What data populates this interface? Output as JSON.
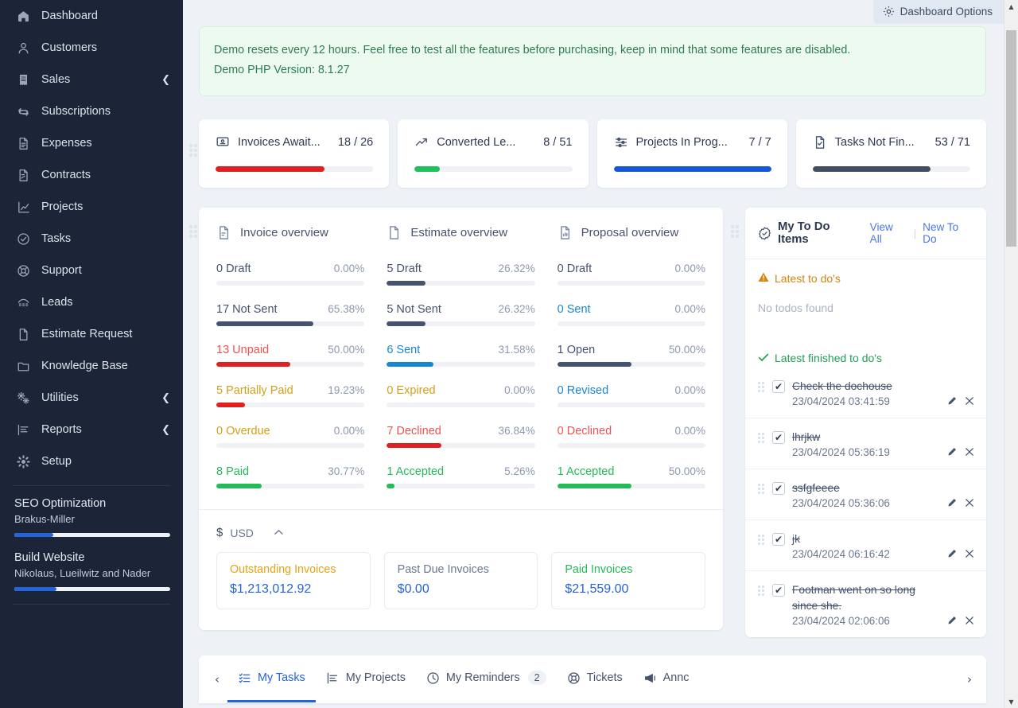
{
  "sidebar": {
    "items": [
      {
        "label": "Dashboard",
        "icon": "home-icon",
        "chevron": false
      },
      {
        "label": "Customers",
        "icon": "user-icon",
        "chevron": false
      },
      {
        "label": "Sales",
        "icon": "receipt-icon",
        "chevron": true
      },
      {
        "label": "Subscriptions",
        "icon": "refresh-icon",
        "chevron": false
      },
      {
        "label": "Expenses",
        "icon": "file-lines-icon",
        "chevron": false
      },
      {
        "label": "Contracts",
        "icon": "file-signature-icon",
        "chevron": false
      },
      {
        "label": "Projects",
        "icon": "chart-icon",
        "chevron": false
      },
      {
        "label": "Tasks",
        "icon": "check-circle-icon",
        "chevron": false
      },
      {
        "label": "Support",
        "icon": "lifebuoy-icon",
        "chevron": false
      },
      {
        "label": "Leads",
        "icon": "phone-icon",
        "chevron": false
      },
      {
        "label": "Estimate Request",
        "icon": "file-icon",
        "chevron": false
      },
      {
        "label": "Knowledge Base",
        "icon": "folder-icon",
        "chevron": false
      },
      {
        "label": "Utilities",
        "icon": "gears-icon",
        "chevron": true
      },
      {
        "label": "Reports",
        "icon": "report-icon",
        "chevron": true
      },
      {
        "label": "Setup",
        "icon": "gear-icon",
        "chevron": false
      }
    ],
    "projects": [
      {
        "title": "SEO Optimization",
        "client": "Brakus-Miller",
        "progress": 25
      },
      {
        "title": "Build Website",
        "client": "Nikolaus, Lueilwitz and Nader",
        "progress": 27
      }
    ]
  },
  "header": {
    "dashboard_options": "Dashboard Options"
  },
  "alert": {
    "line1": "Demo resets every 12 hours. Feel free to test all the features before purchasing, keep in mind that some features are disabled.",
    "line2": "Demo PHP Version: 8.1.27"
  },
  "kpis": [
    {
      "label": "Invoices Await...",
      "value": "18 / 26",
      "icon": "invoice-icon",
      "percent": 69,
      "color": "#e02020"
    },
    {
      "label": "Converted Le...",
      "value": "8 / 51",
      "icon": "trend-up-icon",
      "percent": 16,
      "color": "#1fc15c"
    },
    {
      "label": "Projects In Prog...",
      "value": "7 / 7",
      "icon": "sliders-icon",
      "percent": 100,
      "color": "#1657d9"
    },
    {
      "label": "Tasks Not Fin...",
      "value": "53 / 71",
      "icon": "task-file-icon",
      "percent": 75,
      "color": "#434e63"
    }
  ],
  "overview": [
    {
      "title": "Invoice overview",
      "icon": "invoice-doc-icon",
      "rows": [
        {
          "label": "0 Draft",
          "percent": "0.00%",
          "bar": 0,
          "color": "#46536e",
          "text_color": "#46536e"
        },
        {
          "label": "17 Not Sent",
          "percent": "65.38%",
          "bar": 65.38,
          "color": "#46536e",
          "text_color": "#46536e"
        },
        {
          "label": "13 Unpaid",
          "percent": "50.00%",
          "bar": 50,
          "color": "#e02020",
          "text_color": "#f05252"
        },
        {
          "label": "5 Partially Paid",
          "percent": "19.23%",
          "bar": 19.23,
          "color": "#e02020",
          "text_color": "#d4a017"
        },
        {
          "label": "0 Overdue",
          "percent": "0.00%",
          "bar": 0,
          "color": "#d4a017",
          "text_color": "#d4a017"
        },
        {
          "label": "8 Paid",
          "percent": "30.77%",
          "bar": 30.77,
          "color": "#22bb55",
          "text_color": "#22bb55"
        }
      ]
    },
    {
      "title": "Estimate overview",
      "icon": "estimate-doc-icon",
      "rows": [
        {
          "label": "5 Draft",
          "percent": "26.32%",
          "bar": 26.32,
          "color": "#46536e",
          "text_color": "#46536e"
        },
        {
          "label": "5 Not Sent",
          "percent": "26.32%",
          "bar": 26.32,
          "color": "#46536e",
          "text_color": "#46536e"
        },
        {
          "label": "6 Sent",
          "percent": "31.58%",
          "bar": 31.58,
          "color": "#1787d4",
          "text_color": "#1787d4"
        },
        {
          "label": "0 Expired",
          "percent": "0.00%",
          "bar": 0,
          "color": "#d4a017",
          "text_color": "#d4a017"
        },
        {
          "label": "7 Declined",
          "percent": "36.84%",
          "bar": 36.84,
          "color": "#e02020",
          "text_color": "#f05252"
        },
        {
          "label": "1 Accepted",
          "percent": "5.26%",
          "bar": 5.26,
          "color": "#22bb55",
          "text_color": "#22bb55"
        }
      ]
    },
    {
      "title": "Proposal overview",
      "icon": "proposal-doc-icon",
      "rows": [
        {
          "label": "0 Draft",
          "percent": "0.00%",
          "bar": 0,
          "color": "#46536e",
          "text_color": "#46536e"
        },
        {
          "label": "0 Sent",
          "percent": "0.00%",
          "bar": 0,
          "color": "#1787d4",
          "text_color": "#1787d4"
        },
        {
          "label": "1 Open",
          "percent": "50.00%",
          "bar": 50,
          "color": "#46536e",
          "text_color": "#46536e"
        },
        {
          "label": "0 Revised",
          "percent": "0.00%",
          "bar": 0,
          "color": "#1787d4",
          "text_color": "#1787d4"
        },
        {
          "label": "0 Declined",
          "percent": "0.00%",
          "bar": 0,
          "color": "#e02020",
          "text_color": "#f05252"
        },
        {
          "label": "1 Accepted",
          "percent": "50.00%",
          "bar": 50,
          "color": "#22bb55",
          "text_color": "#22bb55"
        }
      ]
    }
  ],
  "currency": {
    "symbol": "$",
    "code": "USD",
    "cards": [
      {
        "label": "Outstanding Invoices",
        "value": "$1,213,012.92",
        "label_color": "#e6a117"
      },
      {
        "label": "Past Due Invoices",
        "value": "$0.00",
        "label_color": "#6b7890"
      },
      {
        "label": "Paid Invoices",
        "value": "$21,559.00",
        "label_color": "#22bb55"
      }
    ]
  },
  "todo": {
    "title": "My To Do Items",
    "view_all": "View All",
    "new_todo": "New To Do",
    "latest_heading": "Latest to do's",
    "empty_text": "No todos found",
    "finished_heading": "Latest finished to do's",
    "items": [
      {
        "text": "Check the dochouse",
        "date": "23/04/2024 03:41:59"
      },
      {
        "text": "lhrjkw",
        "date": "23/04/2024 05:36:19"
      },
      {
        "text": "ssfgfeeee",
        "date": "23/04/2024 05:36:06"
      },
      {
        "text": "jk",
        "date": "23/04/2024 06:16:42"
      },
      {
        "text": "Footman went on so long since she.",
        "date": "23/04/2024 02:06:06"
      }
    ]
  },
  "bottom_tabs": {
    "prev_arrow": "‹",
    "next_arrow": "›",
    "tabs": [
      {
        "label": "My Tasks",
        "icon": "list-check-icon",
        "badge": "",
        "active": true
      },
      {
        "label": "My Projects",
        "icon": "project-chart-icon",
        "badge": "",
        "active": false
      },
      {
        "label": "My Reminders",
        "icon": "clock-icon",
        "badge": "2",
        "active": false
      },
      {
        "label": "Tickets",
        "icon": "lifebuoy-icon",
        "badge": "",
        "active": false
      },
      {
        "label": "Annc",
        "icon": "megaphone-icon",
        "badge": "",
        "active": false
      }
    ]
  },
  "colors": {
    "sidebar_bg": "#1b2537",
    "accent": "#2563d9",
    "success": "#22bb55",
    "danger": "#e02020",
    "warning": "#d4a017",
    "info": "#1787d4",
    "page_bg": "#eef2f7"
  }
}
